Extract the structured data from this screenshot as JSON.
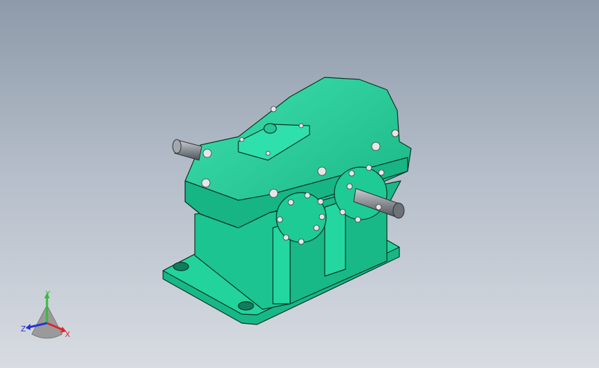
{
  "viewport": {
    "background_top": "#8e9aaa",
    "background_bottom": "#d8dce2"
  },
  "model": {
    "body_color": "#1fcc96",
    "edge_color": "#0a3326",
    "shaft_color": "#8a8f96",
    "bolt_color": "#e6e6e6"
  },
  "triad": {
    "x_label": "X",
    "y_label": "Y",
    "z_label": "Z",
    "x_color": "#e0252a",
    "y_color": "#2fbf3a",
    "z_color": "#2533d8"
  }
}
